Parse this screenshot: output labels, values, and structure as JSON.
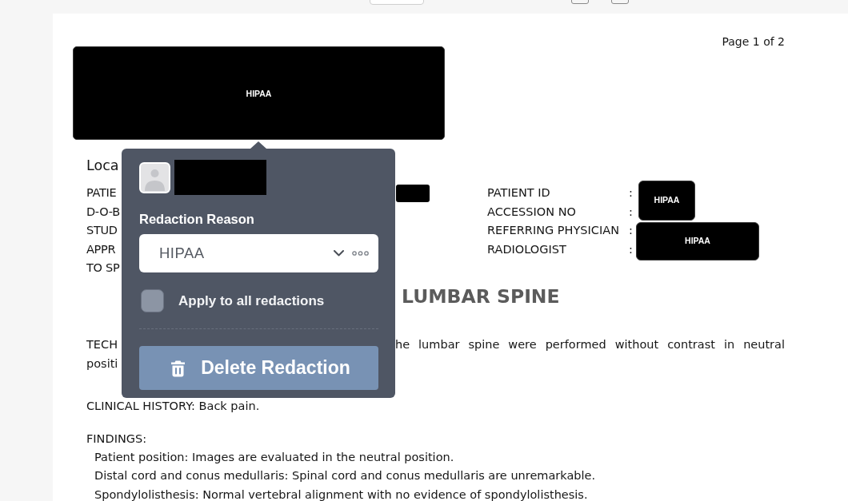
{
  "document": {
    "page_label": "Page 1 of 2",
    "header_redaction": {
      "label": "HIPAA"
    },
    "location_label": "Loca",
    "left_fields": [
      "PATIE",
      "D-O-B",
      "STUD",
      "APPR",
      "TO SP"
    ],
    "right_fields": [
      {
        "label": "PATIENT ID",
        "separator": ":"
      },
      {
        "label": "ACCESSION NO",
        "separator": ":"
      },
      {
        "label": "REFERRING PHYSICIAN",
        "separator": ":"
      },
      {
        "label": "RADIOLOGIST",
        "separator": ":"
      }
    ],
    "field_redactions": [
      {
        "label": "HIPAA"
      },
      {
        "label": "HIPAA"
      }
    ],
    "title": "LUMBAR SPINE",
    "technique": {
      "line_1_start": "TECH",
      "line_1_end": "he lumbar spine were performed without contrast in neutral",
      "line_2": "positi"
    },
    "clinical_history": "CLINICAL HISTORY: Back pain.",
    "findings": {
      "heading": "FINDINGS:",
      "items": [
        "Patient position: Images are evaluated in the neutral position.",
        "Distal cord and conus medullaris: Spinal cord and conus medullaris are unremarkable.",
        "Spondylolisthesis: Normal vertebral alignment with no evidence of spondylolisthesis."
      ]
    }
  },
  "popup": {
    "reason_label": "Redaction Reason",
    "reason_select": {
      "value": "HIPAA"
    },
    "apply_to_all": {
      "label": "Apply to all redactions",
      "checked": false
    },
    "delete_button": "Delete Redaction"
  }
}
